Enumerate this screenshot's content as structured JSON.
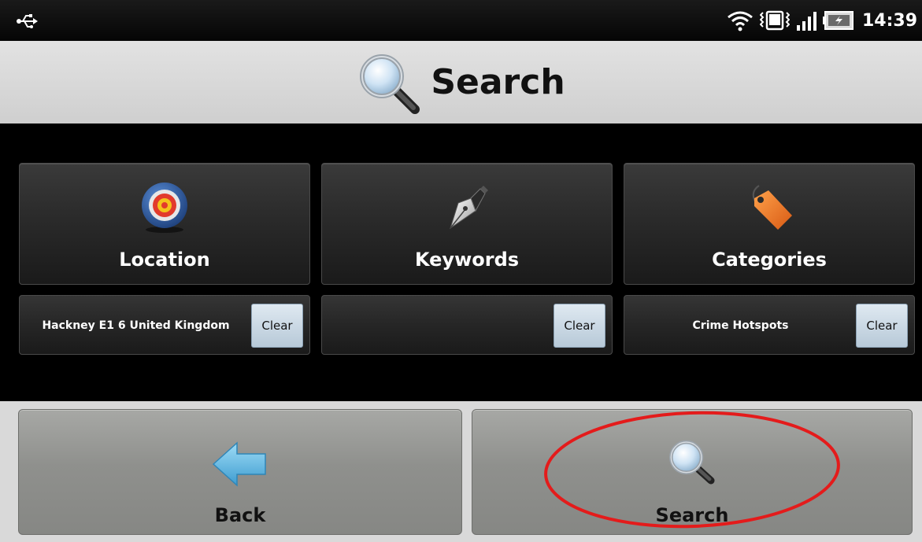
{
  "status_bar": {
    "time": "14:39",
    "icons": [
      "usb-icon",
      "wifi-icon",
      "vibrate-icon",
      "signal-icon",
      "battery-icon"
    ]
  },
  "title_bar": {
    "title": "Search",
    "icon": "magnifier-icon"
  },
  "tiles": [
    {
      "label": "Location",
      "icon": "target-icon"
    },
    {
      "label": "Keywords",
      "icon": "pen-nib-icon"
    },
    {
      "label": "Categories",
      "icon": "tag-icon"
    }
  ],
  "fields": [
    {
      "value": "Hackney E1 6 United Kingdom",
      "clear_label": "Clear"
    },
    {
      "value": "",
      "clear_label": "Clear"
    },
    {
      "value": "Crime Hotspots",
      "clear_label": "Clear"
    }
  ],
  "bottom_buttons": {
    "back_label": "Back",
    "back_icon": "arrow-left-icon",
    "search_label": "Search",
    "search_icon": "magnifier-icon"
  },
  "colors": {
    "annotation": "#e41b1b",
    "arrow": "#5fb6e0",
    "tag": "#f07a2a"
  }
}
